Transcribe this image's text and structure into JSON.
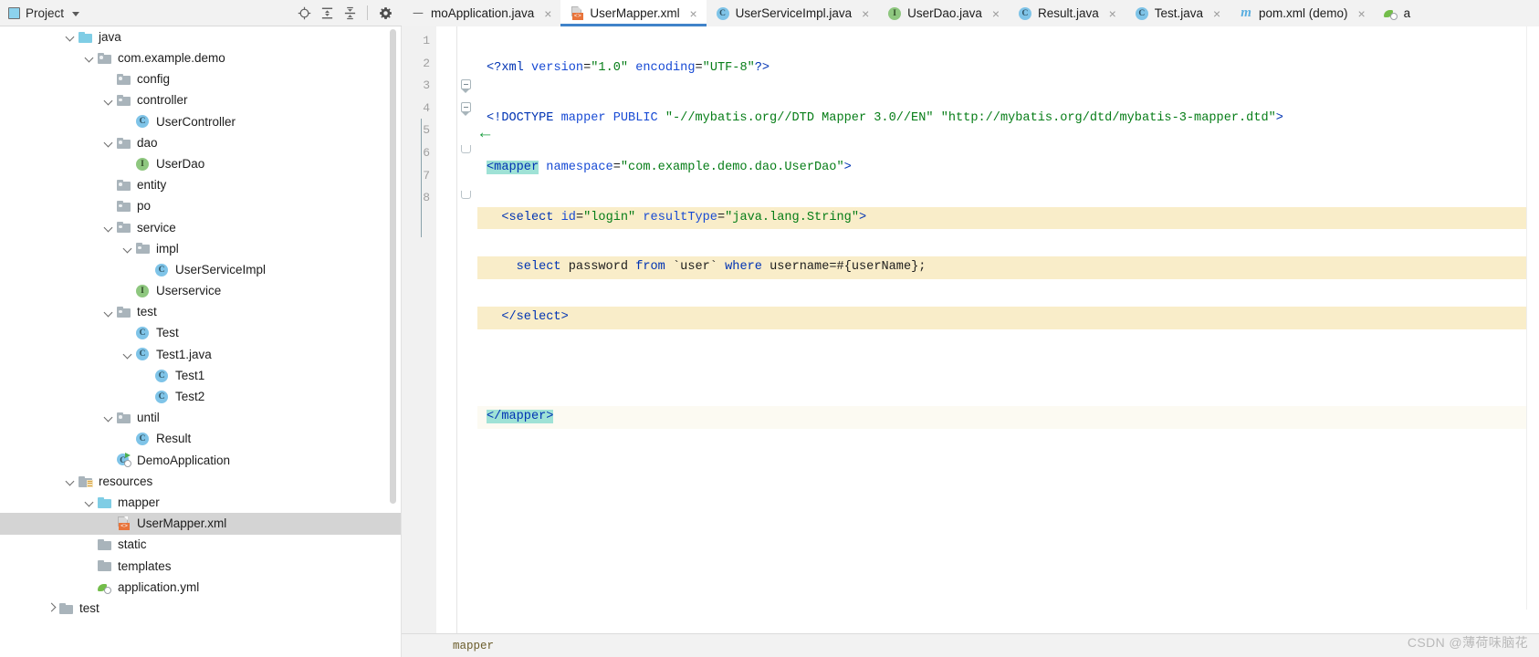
{
  "project_panel": {
    "title": "Project",
    "title_icon": "project-window-icon",
    "toolbar": [
      {
        "name": "locate-in-tree-icon",
        "tooltip": "Select Opened File"
      },
      {
        "name": "expand-all-icon",
        "tooltip": "Expand All"
      },
      {
        "name": "collapse-all-icon",
        "tooltip": "Collapse All"
      },
      {
        "name": "settings-gear-icon",
        "tooltip": "Options"
      }
    ],
    "tree": [
      {
        "label": "java",
        "indent": 3,
        "arrow": "open",
        "icon": "folder-source-blue",
        "selected": false
      },
      {
        "label": "com.example.demo",
        "indent": 4,
        "arrow": "open",
        "icon": "folder-package",
        "selected": false
      },
      {
        "label": "config",
        "indent": 5,
        "arrow": "none",
        "icon": "folder-package",
        "selected": false
      },
      {
        "label": "controller",
        "indent": 5,
        "arrow": "open",
        "icon": "folder-package",
        "selected": false
      },
      {
        "label": "UserController",
        "indent": 6,
        "arrow": "none",
        "icon": "class-icon",
        "selected": false
      },
      {
        "label": "dao",
        "indent": 5,
        "arrow": "open",
        "icon": "folder-package",
        "selected": false
      },
      {
        "label": "UserDao",
        "indent": 6,
        "arrow": "none",
        "icon": "interface-icon",
        "selected": false
      },
      {
        "label": "entity",
        "indent": 5,
        "arrow": "none",
        "icon": "folder-package",
        "selected": false
      },
      {
        "label": "po",
        "indent": 5,
        "arrow": "none",
        "icon": "folder-package",
        "selected": false
      },
      {
        "label": "service",
        "indent": 5,
        "arrow": "open",
        "icon": "folder-package",
        "selected": false
      },
      {
        "label": "impl",
        "indent": 6,
        "arrow": "open",
        "icon": "folder-package",
        "selected": false
      },
      {
        "label": "UserServiceImpl",
        "indent": 7,
        "arrow": "none",
        "icon": "class-icon",
        "selected": false
      },
      {
        "label": "Userservice",
        "indent": 6,
        "arrow": "none",
        "icon": "interface-icon",
        "selected": false
      },
      {
        "label": "test",
        "indent": 5,
        "arrow": "open",
        "icon": "folder-package",
        "selected": false
      },
      {
        "label": "Test",
        "indent": 6,
        "arrow": "none",
        "icon": "class-icon",
        "selected": false
      },
      {
        "label": "Test1.java",
        "indent": 6,
        "arrow": "open",
        "icon": "class-icon",
        "selected": false
      },
      {
        "label": "Test1",
        "indent": 7,
        "arrow": "none",
        "icon": "class-icon",
        "selected": false
      },
      {
        "label": "Test2",
        "indent": 7,
        "arrow": "none",
        "icon": "class-icon",
        "selected": false
      },
      {
        "label": "until",
        "indent": 5,
        "arrow": "open",
        "icon": "folder-package",
        "selected": false
      },
      {
        "label": "Result",
        "indent": 6,
        "arrow": "none",
        "icon": "class-icon",
        "selected": false
      },
      {
        "label": "DemoApplication",
        "indent": 5,
        "arrow": "none",
        "icon": "runnable-class-icon",
        "selected": false
      },
      {
        "label": "resources",
        "indent": 3,
        "arrow": "open",
        "icon": "folder-resources",
        "selected": false
      },
      {
        "label": "mapper",
        "indent": 4,
        "arrow": "open",
        "icon": "folder-plain-blue",
        "selected": false
      },
      {
        "label": "UserMapper.xml",
        "indent": 5,
        "arrow": "none",
        "icon": "xml-file-icon",
        "selected": true
      },
      {
        "label": "static",
        "indent": 4,
        "arrow": "none",
        "icon": "folder-plain-gray",
        "selected": false
      },
      {
        "label": "templates",
        "indent": 4,
        "arrow": "none",
        "icon": "folder-plain-gray",
        "selected": false
      },
      {
        "label": "application.yml",
        "indent": 4,
        "arrow": "none",
        "icon": "yaml-file-icon",
        "selected": false
      },
      {
        "label": "test",
        "indent": 2,
        "arrow": "closed",
        "icon": "folder-plain-gray",
        "selected": false
      }
    ]
  },
  "editor_tabs": [
    {
      "label": "moApplication.java",
      "icon": "modified-dash-icon",
      "active": false,
      "close": "×"
    },
    {
      "label": "UserMapper.xml",
      "icon": "xml-file-icon",
      "active": true,
      "close": "×"
    },
    {
      "label": "UserServiceImpl.java",
      "icon": "class-icon",
      "active": false,
      "close": "×"
    },
    {
      "label": "UserDao.java",
      "icon": "interface-icon",
      "active": false,
      "close": "×"
    },
    {
      "label": "Result.java",
      "icon": "class-icon",
      "active": false,
      "close": "×"
    },
    {
      "label": "Test.java",
      "icon": "class-icon",
      "active": false,
      "close": "×"
    },
    {
      "label": "pom.xml (demo)",
      "icon": "maven-m-icon",
      "active": false,
      "close": "×"
    },
    {
      "label": "a",
      "icon": "yaml-file-icon",
      "active": false,
      "close": ""
    }
  ],
  "editor": {
    "filename": "UserMapper.xml",
    "line_numbers": [
      "1",
      "2",
      "3",
      "4",
      "5",
      "6",
      "7",
      "8"
    ],
    "lines": [
      "<?xml version=\"1.0\" encoding=\"UTF-8\"?>",
      "<!DOCTYPE mapper PUBLIC \"-//mybatis.org//DTD Mapper 3.0//EN\" \"http://mybatis.org/dtd/mybatis-3-mapper.dtd\">",
      "<mapper namespace=\"com.example.demo.dao.UserDao\">",
      "    <select id=\"login\" resultType=\"java.lang.String\">",
      "        select password from `user` where username=#{userName};",
      "    </select>",
      "",
      "</mapper>"
    ],
    "gutter_marker_line": "4",
    "gutter_marker_icon": "green-left-arrow-icon",
    "matched_tag_highlight": [
      "<mapper",
      "</mapper>"
    ],
    "breadcrumb": "mapper"
  },
  "watermark": "CSDN @薄荷味脑花"
}
